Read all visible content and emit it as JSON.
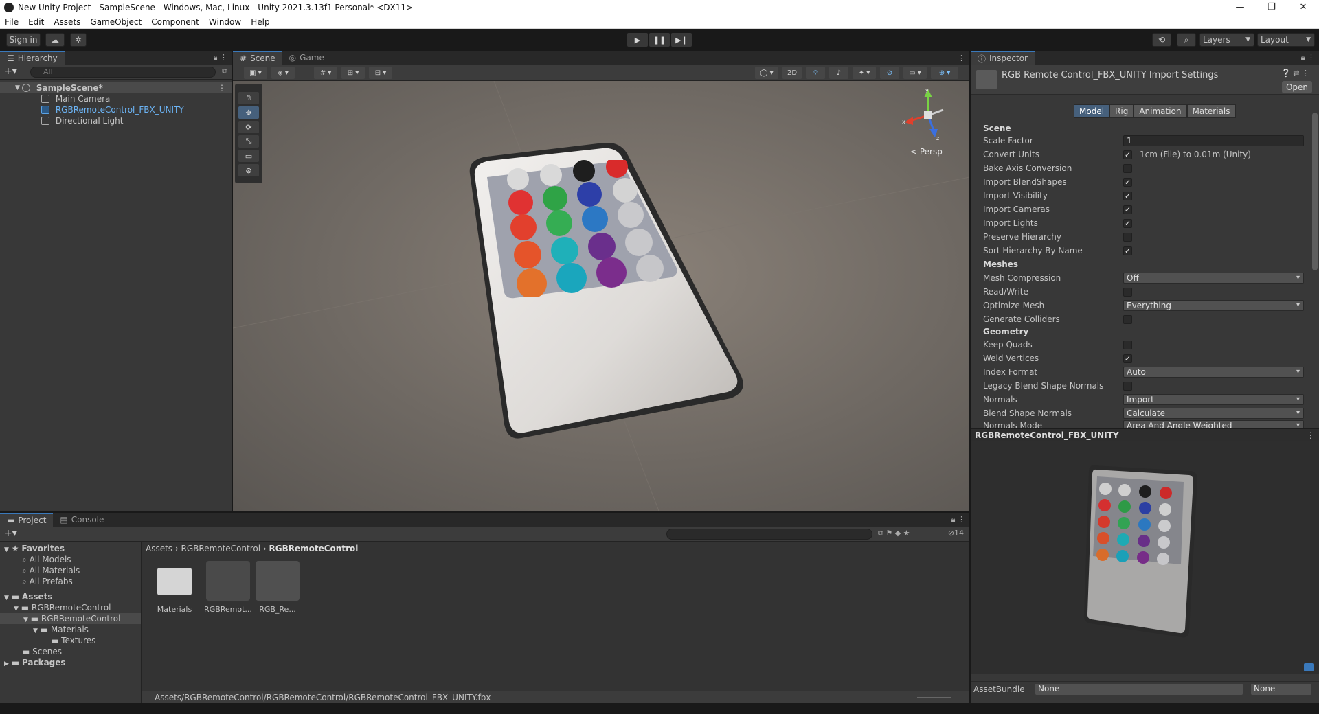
{
  "window": {
    "title": "New Unity Project - SampleScene - Windows, Mac, Linux - Unity 2021.3.13f1 Personal* <DX11>",
    "controls": [
      "—",
      "❐",
      "✕"
    ]
  },
  "menu": [
    "File",
    "Edit",
    "Assets",
    "GameObject",
    "Component",
    "Window",
    "Help"
  ],
  "toolbar": {
    "sign_in": "Sign in",
    "layers": "Layers",
    "layout": "Layout"
  },
  "hierarchy": {
    "tab": "Hierarchy",
    "search_placeholder": "All",
    "scene": "SampleScene*",
    "items": [
      "Main Camera",
      "RGBRemoteControl_FBX_UNITY",
      "Directional Light"
    ]
  },
  "scene_view": {
    "tabs": [
      "Scene",
      "Game"
    ],
    "mode_2d": "2D",
    "persp_label": "< Persp",
    "axis_labels": [
      "y",
      "x",
      "z"
    ]
  },
  "inspector": {
    "tab": "Inspector",
    "title": "RGB Remote Control_FBX_UNITY Import Settings",
    "open_button": "Open",
    "tabs": [
      "Model",
      "Rig",
      "Animation",
      "Materials"
    ],
    "sections": {
      "scene": "Scene",
      "meshes": "Meshes",
      "geometry": "Geometry"
    },
    "scene_props": {
      "scale_factor_label": "Scale Factor",
      "scale_factor_value": "1",
      "convert_units_label": "Convert Units",
      "convert_units_note": "1cm (File) to 0.01m (Unity)",
      "bake_axis_label": "Bake Axis Conversion",
      "import_blendshapes_label": "Import BlendShapes",
      "import_visibility_label": "Import Visibility",
      "import_cameras_label": "Import Cameras",
      "import_lights_label": "Import Lights",
      "preserve_hierarchy_label": "Preserve Hierarchy",
      "sort_hierarchy_label": "Sort Hierarchy By Name"
    },
    "mesh_props": {
      "mesh_compression_label": "Mesh Compression",
      "mesh_compression_value": "Off",
      "read_write_label": "Read/Write",
      "optimize_mesh_label": "Optimize Mesh",
      "optimize_mesh_value": "Everything",
      "generate_colliders_label": "Generate Colliders"
    },
    "geometry_props": {
      "keep_quads_label": "Keep Quads",
      "weld_vertices_label": "Weld Vertices",
      "index_format_label": "Index Format",
      "index_format_value": "Auto",
      "legacy_blend_label": "Legacy Blend Shape Normals",
      "normals_label": "Normals",
      "normals_value": "Import",
      "blend_shape_normals_label": "Blend Shape Normals",
      "blend_shape_normals_value": "Calculate",
      "normals_mode_label": "Normals Mode",
      "normals_mode_value": "Area And Angle Weighted"
    },
    "checks": {
      "convert_units": true,
      "bake_axis": false,
      "import_blendshapes": true,
      "import_visibility": true,
      "import_cameras": true,
      "import_lights": true,
      "preserve_hierarchy": false,
      "sort_hierarchy": true,
      "read_write": false,
      "generate_colliders": false,
      "keep_quads": false,
      "weld_vertices": true,
      "legacy_blend": false
    },
    "preview_title": "RGBRemoteControl_FBX_UNITY",
    "assetbundle_label": "AssetBundle",
    "assetbundle_value": "None",
    "assetbundle_variant": "None"
  },
  "project": {
    "tabs": [
      "Project",
      "Console"
    ],
    "hidden_count": "14",
    "favorites_label": "Favorites",
    "favorites": [
      "All Models",
      "All Materials",
      "All Prefabs"
    ],
    "assets_label": "Assets",
    "tree": [
      "RGBRemoteControl",
      "RGBRemoteControl",
      "Materials",
      "Textures",
      "Scenes"
    ],
    "packages_label": "Packages",
    "breadcrumb": [
      "Assets",
      "RGBRemoteControl",
      "RGBRemoteControl"
    ],
    "assets": [
      "Materials",
      "RGBRemot...",
      "RGB_Re..."
    ],
    "path": "Assets/RGBRemoteControl/RGBRemoteControl/RGBRemoteControl_FBX_UNITY.fbx"
  },
  "colors": {
    "accent": "#3a79bb",
    "selected_tab": "#46607c",
    "panel_bg": "#383838",
    "link_blue": "#6cb4f5"
  }
}
